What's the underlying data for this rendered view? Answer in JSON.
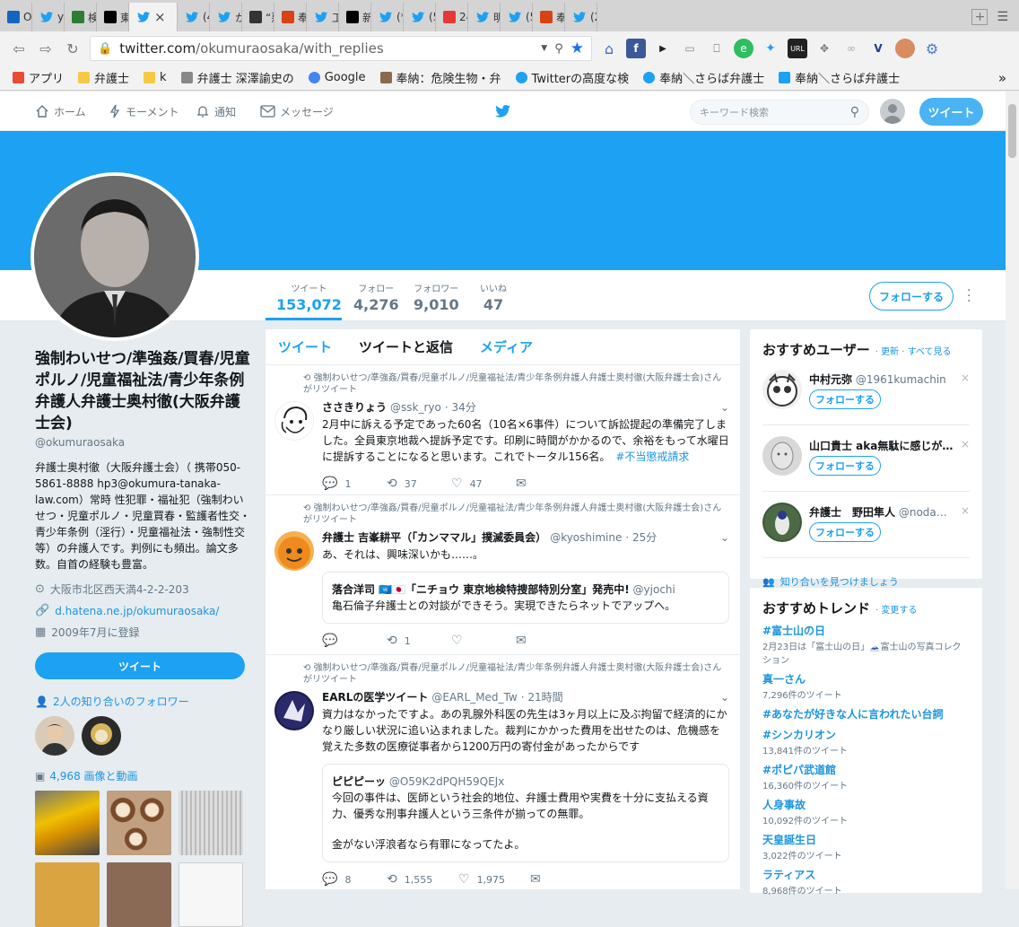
{
  "tabs": [
    {
      "label": "Or",
      "icon": "y-icon",
      "color": "#1565c0"
    },
    {
      "label": "ys",
      "icon": "twitter-icon",
      "color": "#1da1f2"
    },
    {
      "label": "検",
      "icon": "bug-icon",
      "color": "#2e7d32"
    },
    {
      "label": "東",
      "icon": "tk-icon",
      "color": "#000000"
    },
    {
      "label": "",
      "icon": "twitter-icon",
      "color": "#1da1f2",
      "active": true
    },
    {
      "label": "(4)",
      "icon": "twitter-icon",
      "color": "#1da1f2"
    },
    {
      "label": "か",
      "icon": "twitter-icon",
      "color": "#1da1f2"
    },
    {
      "label": "“悪",
      "icon": "circle-icon",
      "color": "#333333"
    },
    {
      "label": "奉",
      "icon": "hedgehog-icon",
      "color": "#d84315"
    },
    {
      "label": "工",
      "icon": "twitter-icon",
      "color": "#1da1f2"
    },
    {
      "label": "新",
      "icon": "f-icon",
      "color": "#000000"
    },
    {
      "label": "(*)",
      "icon": "twitter-icon",
      "color": "#1da1f2"
    },
    {
      "label": "(5)",
      "icon": "twitter-icon",
      "color": "#1da1f2"
    },
    {
      "label": "24",
      "icon": "yahoo-icon",
      "color": "#e53935"
    },
    {
      "label": "明",
      "icon": "twitter-icon",
      "color": "#1da1f2"
    },
    {
      "label": "(5)",
      "icon": "twitter-icon",
      "color": "#1da1f2"
    },
    {
      "label": "奉",
      "icon": "hedgehog-icon",
      "color": "#d84315"
    },
    {
      "label": "(2)",
      "icon": "twitter-icon",
      "color": "#1da1f2"
    }
  ],
  "address": {
    "host": "twitter.com",
    "path": "/okumuraosaka/with_replies"
  },
  "bookmarks": [
    {
      "label": "アプリ",
      "icon": "apps-icon"
    },
    {
      "label": "弁護士",
      "icon": "folder-icon"
    },
    {
      "label": "k",
      "icon": "folder-icon"
    },
    {
      "label": "弁護士 深澤諭史の",
      "icon": "page-icon"
    },
    {
      "label": "Google",
      "icon": "google-icon"
    },
    {
      "label": "奉納：危険生物・弁",
      "icon": "hedgehog-icon"
    },
    {
      "label": "Twitterの高度な検",
      "icon": "twitter-icon"
    },
    {
      "label": "奉納＼さらば弁護士",
      "icon": "twitter-icon"
    },
    {
      "label": "奉納＼さらば弁護士",
      "icon": "t-icon"
    }
  ],
  "nav": {
    "home": "ホーム",
    "moments": "モーメント",
    "notifications": "通知",
    "messages": "メッセージ",
    "search_placeholder": "キーワード検索",
    "tweet_button": "ツイート"
  },
  "stats": [
    {
      "label": "ツイート",
      "value": "153,072",
      "active": true
    },
    {
      "label": "フォロー",
      "value": "4,276"
    },
    {
      "label": "フォロワー",
      "value": "9,010"
    },
    {
      "label": "いいね",
      "value": "47"
    }
  ],
  "follow_button": "フォローする",
  "profile": {
    "name": "強制わいせつ/準強姦/買春/児童ポルノ/児童福祉法/青少年条例弁護人弁護士奥村徹(大阪弁護士会)",
    "handle": "@okumuraosaka",
    "bio": "弁護士奥村徹（大阪弁護士会）（ 携帯050-5861-8888 hp3@okumura-tanaka-law.com）常時 性犯罪・福祉犯（強制わいせつ・児童ポルノ・児童買春・監護者性交・青少年条例（淫行）・児童福祉法・強制性交等）の弁護人です。判例にも頻出。論文多数。自首の経験も豊富。",
    "location": "大阪市北区西天満4-2-2-203",
    "url": "d.hatena.ne.jp/okumuraosaka/",
    "joined": "2009年7月に登録",
    "tweet_button": "ツイート",
    "known_followers": "2人の知り合いのフォロワー",
    "media": "4,968 画像と動画"
  },
  "timeline": {
    "tabs": [
      "ツイート",
      "ツイートと返信",
      "メディア"
    ],
    "active_tab": 1,
    "tweets": [
      {
        "retweeter": "強制わいせつ/準強姦/買春/児童ポルノ/児童福祉法/青少年条例弁護人弁護士奥村徹(大阪弁護士会)さんがリツイート",
        "name": "ささきりょう",
        "handle": "@ssk_ryo",
        "time": "· 34分",
        "text": "2月中に訴える予定であった60名（10名×6事件）について訴訟提起の準備完了しました。全員東京地裁へ提訴予定です。印刷に時間がかかるので、余裕をもって水曜日に提訴することになると思います。これでトータル156名。",
        "hashtag": "#不当懲戒請求",
        "replies": "1",
        "retweets": "37",
        "likes": "47"
      },
      {
        "retweeter": "強制わいせつ/準強姦/買春/児童ポルノ/児童福祉法/青少年条例弁護人弁護士奥村徹(大阪弁護士会)さんがリツイート",
        "name": "弁護士 吉峯耕平（「カンママル」撲滅委員会）",
        "handle": "@kyoshimine",
        "time": "· 25分",
        "text": "あ、それは、興味深いかも……。",
        "quote_name": "落合洋司 🇺🇳🇯🇵「ニチョウ 東京地検特捜部特別分室」発売中!",
        "quote_handle": "@yjochi",
        "quote_text": "亀石倫子弁護士との対談ができそう。実現できたらネットでアップへ。",
        "replies": "",
        "retweets": "1",
        "likes": ""
      },
      {
        "retweeter": "強制わいせつ/準強姦/買春/児童ポルノ/児童福祉法/青少年条例弁護人弁護士奥村徹(大阪弁護士会)さんがリツイート",
        "name": "EARLの医学ツイート",
        "handle": "@EARL_Med_Tw",
        "time": "· 21時間",
        "text": "資力はなかったですよ。あの乳腺外科医の先生は3ヶ月以上に及ぶ拘留で経済的にかなり厳しい状況に追い込まれました。裁判にかかった費用を出せたのは、危機感を覚えた多数の医療従事者から1200万円の寄付金があったからです",
        "quote_name": "ピピピーッ",
        "quote_handle": "@O59K2dPQH59QEJx",
        "quote_text": "今回の事件は、医師という社会的地位、弁護士費用や実費を十分に支払える資力、優秀な刑事弁護人という三条件が揃っての無罪。",
        "quote_text2": "金がない浮浪者なら有罪になってたよ。",
        "replies": "8",
        "retweets": "1,555",
        "likes": "1,975"
      }
    ]
  },
  "wtf": {
    "title": "おすすめユーザー",
    "refresh": "· 更新 · すべて見る",
    "users": [
      {
        "name": "中村元弥",
        "handle": "@1961kumachin"
      },
      {
        "name": "山口貴士 aka無駄に感じが…",
        "handle": ""
      },
      {
        "name": "弁護士　野田隼人",
        "handle": "@noda…"
      }
    ],
    "follow": "フォローする",
    "find_friends": "知り合いを見つけましょう"
  },
  "trends": {
    "title": "おすすめトレンド",
    "change": "· 変更する",
    "items": [
      {
        "name": "#富士山の日",
        "count": "2月23日は「富士山の日」🗻富士山の写真コレクション"
      },
      {
        "name": "真一さん",
        "count": "7,296件のツイート"
      },
      {
        "name": "#あなたが好きな人に言われたい台詞",
        "count": ""
      },
      {
        "name": "#シンカリオン",
        "count": "13,841件のツイート"
      },
      {
        "name": "#ポピパ武道館",
        "count": "16,360件のツイート"
      },
      {
        "name": "人身事故",
        "count": "10,092件のツイート"
      },
      {
        "name": "天皇誕生日",
        "count": "3,022件のツイート"
      },
      {
        "name": "ラティアス",
        "count": "8,968件のツイート"
      }
    ]
  }
}
